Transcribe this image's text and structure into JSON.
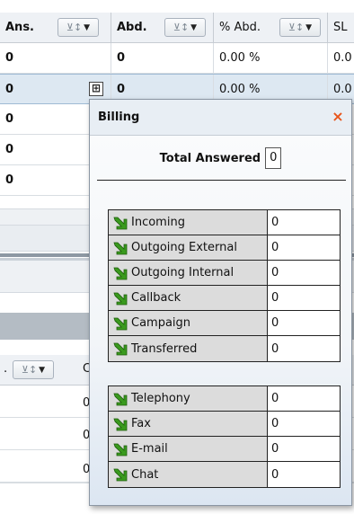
{
  "grid": {
    "columns": [
      {
        "label": "Ans.",
        "bold": true
      },
      {
        "label": "Abd.",
        "bold": true
      },
      {
        "label": "% Abd.",
        "bold": false
      },
      {
        "label": "SL",
        "bold": false
      }
    ],
    "filter_icon": "filter-sort-icon",
    "rows": [
      {
        "ans": "0",
        "abd": "0",
        "pct": "0.00 %",
        "sl": "0.0"
      },
      {
        "ans": "0",
        "abd": "0",
        "pct": "0.00 %",
        "sl": "0.0"
      },
      {
        "ans": "0"
      },
      {
        "ans": "0"
      },
      {
        "ans": "0"
      }
    ],
    "expander_symbol": "⊞"
  },
  "bottom_grid": {
    "header_prefix": ".",
    "header_col": "C",
    "cells": [
      "0",
      "0",
      "0"
    ]
  },
  "popup": {
    "title": "Billing",
    "close_symbol": "×",
    "total_label": "Total Answered",
    "total_value": "0",
    "group1": [
      {
        "label": "Incoming",
        "value": "0"
      },
      {
        "label": "Outgoing External",
        "value": "0"
      },
      {
        "label": "Outgoing Internal",
        "value": "0"
      },
      {
        "label": "Callback",
        "value": "0"
      },
      {
        "label": "Campaign",
        "value": "0"
      },
      {
        "label": "Transferred",
        "value": "0"
      }
    ],
    "group2": [
      {
        "label": "Telephony",
        "value": "0"
      },
      {
        "label": "Fax",
        "value": "0"
      },
      {
        "label": "E-mail",
        "value": "0"
      },
      {
        "label": "Chat",
        "value": "0"
      }
    ],
    "row_icon": "green-arrow-icon"
  },
  "colors": {
    "close": "#e8541a",
    "arrow": "#3a9a1e",
    "header_bg": "#eef1f5"
  }
}
